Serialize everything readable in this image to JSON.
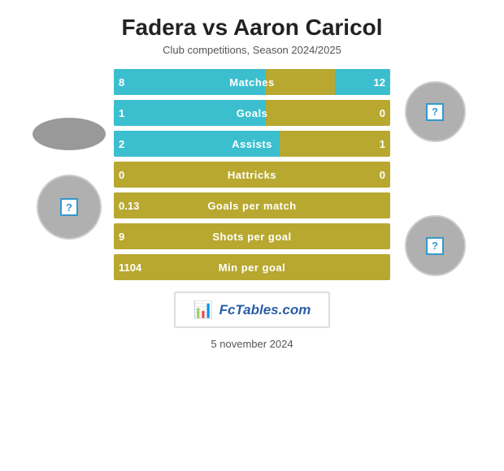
{
  "header": {
    "title": "Fadera vs Aaron Caricol",
    "subtitle": "Club competitions, Season 2024/2025"
  },
  "stats": [
    {
      "label": "Matches",
      "left_value": "8",
      "right_value": "12",
      "left_pct": 60,
      "right_pct": 0,
      "both_fill": true
    },
    {
      "label": "Goals",
      "left_value": "1",
      "right_value": "0",
      "left_pct": 60,
      "right_pct": 0,
      "both_fill": false
    },
    {
      "label": "Assists",
      "left_value": "2",
      "right_value": "1",
      "left_pct": 70,
      "right_pct": 0,
      "both_fill": false
    },
    {
      "label": "Hattricks",
      "left_value": "0",
      "right_value": "0",
      "left_pct": 0,
      "right_pct": 0,
      "both_fill": false
    },
    {
      "label": "Goals per match",
      "left_value": "0.13",
      "right_value": "",
      "left_pct": 0,
      "right_pct": 0,
      "both_fill": false
    },
    {
      "label": "Shots per goal",
      "left_value": "9",
      "right_value": "",
      "left_pct": 0,
      "right_pct": 0,
      "both_fill": false
    },
    {
      "label": "Min per goal",
      "left_value": "1104",
      "right_value": "",
      "left_pct": 0,
      "right_pct": 0,
      "both_fill": false
    }
  ],
  "logo": {
    "text": "FcTables.com"
  },
  "date": "5 november 2024"
}
